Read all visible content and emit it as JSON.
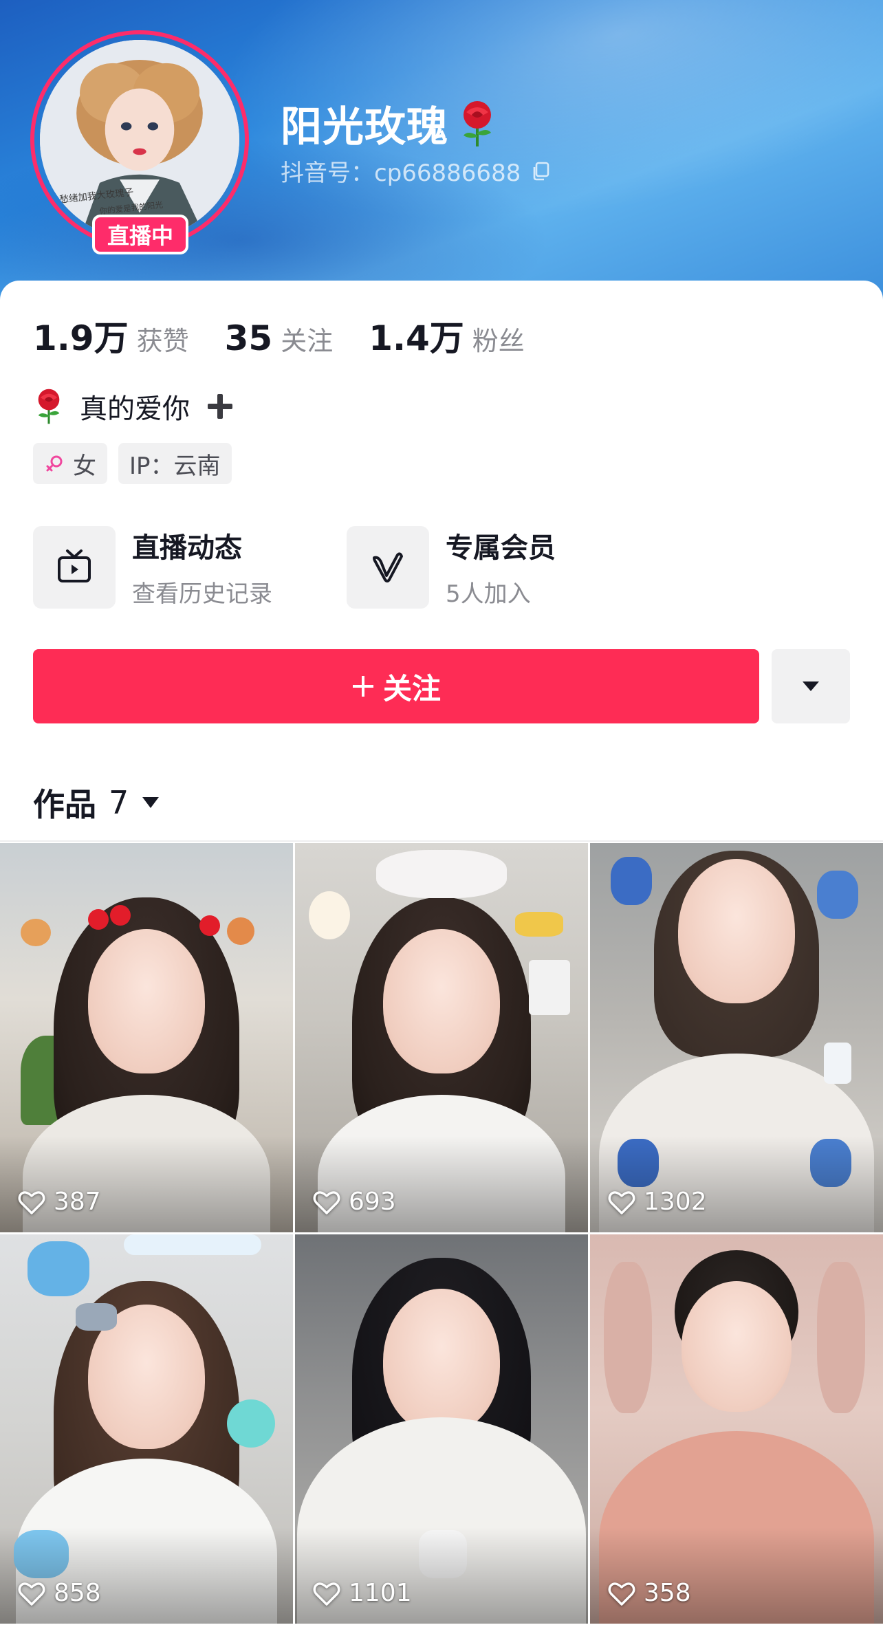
{
  "profile": {
    "name": "阳光玫瑰",
    "douyin_id": "抖音号：cp66886688",
    "live_badge": "直播中"
  },
  "stats": [
    {
      "value": "1.9万",
      "label": "获赞"
    },
    {
      "value": "35",
      "label": "关注"
    },
    {
      "value": "1.4万",
      "label": "粉丝"
    }
  ],
  "bio": {
    "text": "真的爱你"
  },
  "tags": {
    "gender": "女",
    "ip": "IP：云南"
  },
  "features": [
    {
      "title": "直播动态",
      "subtitle": "查看历史记录",
      "icon": "tv-icon"
    },
    {
      "title": "专属会员",
      "subtitle": "5人加入",
      "icon": "v-logo-icon"
    }
  ],
  "actions": {
    "follow_label": "关注"
  },
  "works": {
    "label": "作品",
    "count": "7"
  },
  "videos": [
    {
      "likes": "387"
    },
    {
      "likes": "693"
    },
    {
      "likes": "1302"
    },
    {
      "likes": "858"
    },
    {
      "likes": "1101"
    },
    {
      "likes": "358"
    }
  ],
  "colors": {
    "accent": "#fe2c55",
    "banner_blue": "#2a86dc",
    "text_primary": "#161823",
    "text_secondary": "#8a8b91"
  }
}
